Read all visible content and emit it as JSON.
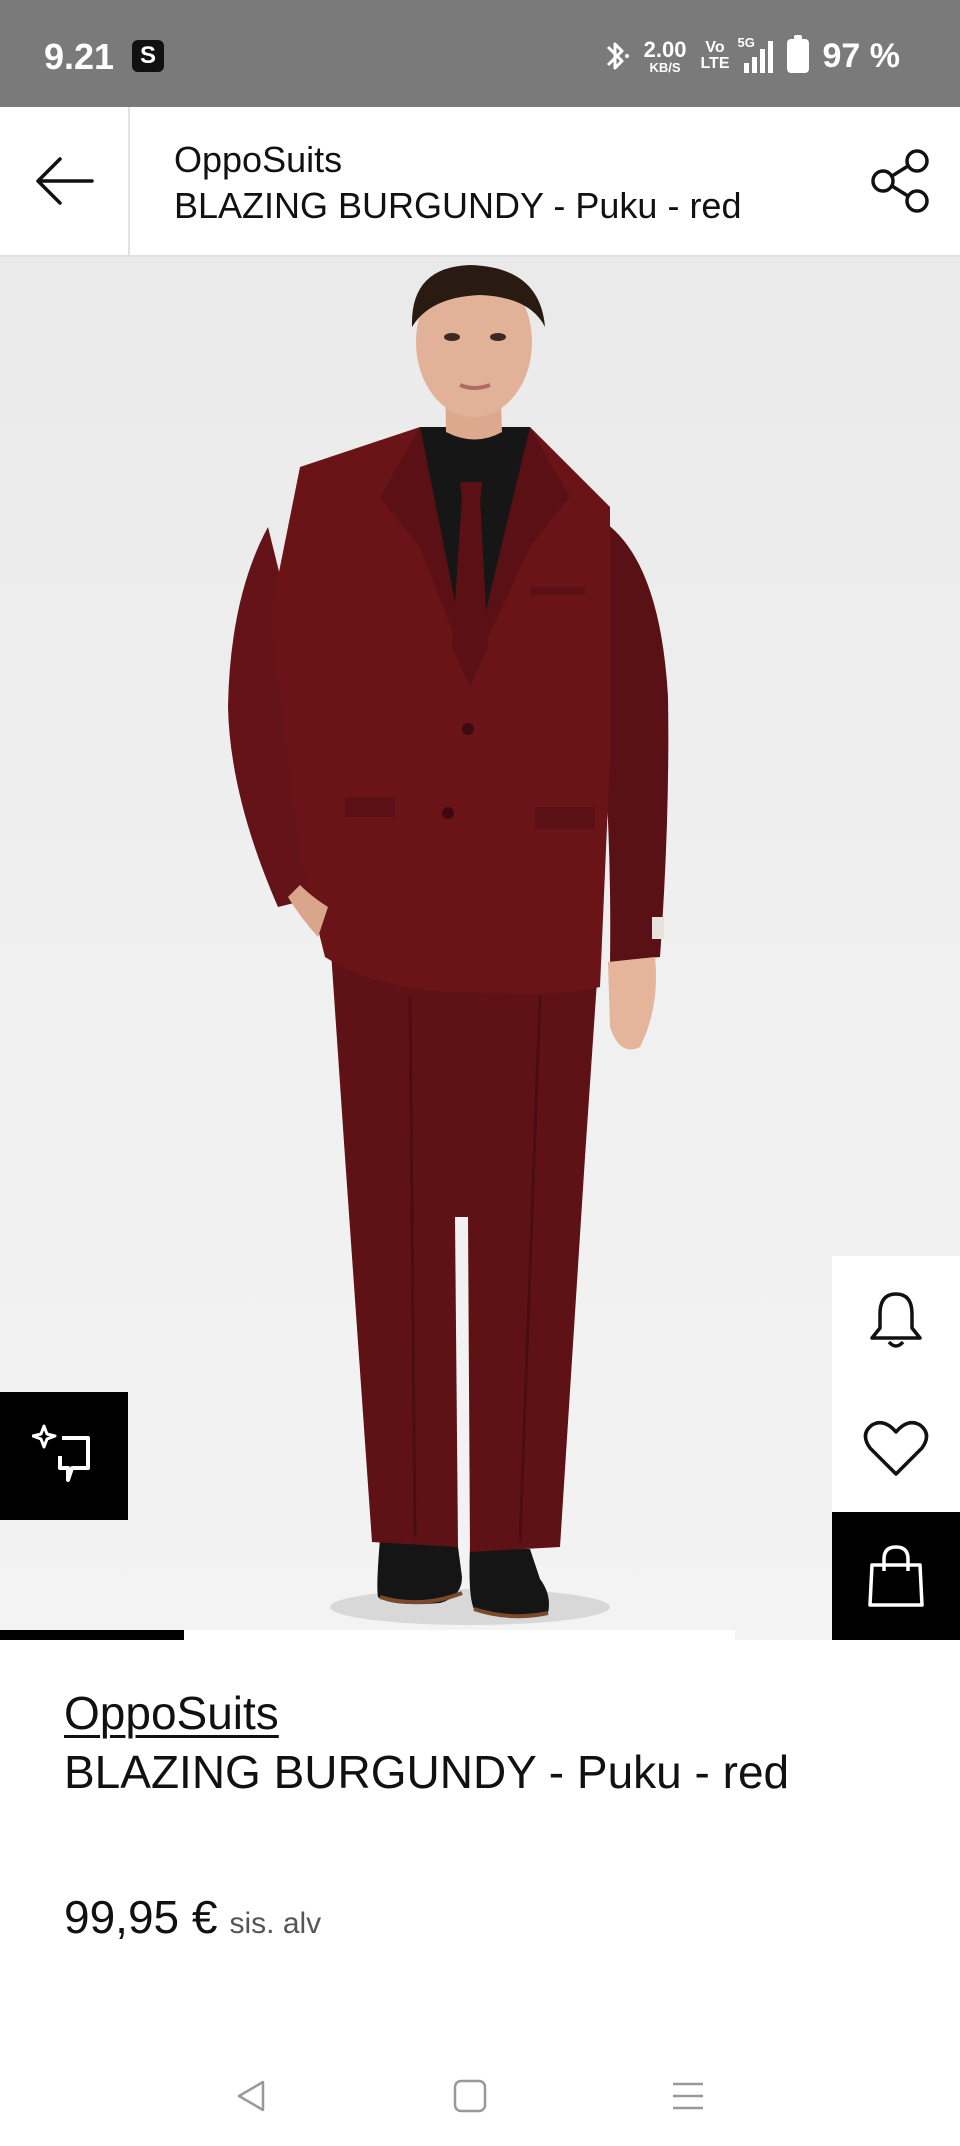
{
  "status_bar": {
    "time": "9.21",
    "app_badge": "S",
    "net_speed_value": "2.00",
    "net_speed_unit": "KB/S",
    "volte_top": "Vo",
    "volte_bottom": "LTE",
    "signal_label": "5G",
    "battery_text": "97 %"
  },
  "header": {
    "brand": "OppoSuits",
    "product": "BLAZING BURGUNDY - Puku - red"
  },
  "product": {
    "brand": "OppoSuits",
    "name": "BLAZING BURGUNDY - Puku - red",
    "price": "99,95 €",
    "vat_note": "sis. alv"
  },
  "carousel": {
    "current_image": 1,
    "total_images": 4
  },
  "icons": {
    "back": "arrow-left-icon",
    "share": "share-icon",
    "notify": "bell-icon",
    "wishlist": "heart-icon",
    "cart": "shopping-bag-icon",
    "compare": "compare-sparkle-icon"
  },
  "colors": {
    "suit": "#6b1418",
    "status_bar": "#7a7a7a",
    "accent": "#000000"
  }
}
